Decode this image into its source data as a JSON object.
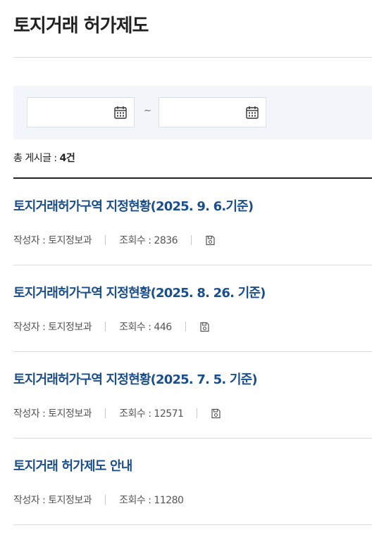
{
  "page": {
    "title": "토지거래 허가제도"
  },
  "filter": {
    "start_date_value": "",
    "end_date_value": "",
    "separator": "~",
    "calendar_icon": "calendar-icon"
  },
  "summary": {
    "label": "총 게시글 : ",
    "count": "4건"
  },
  "posts": [
    {
      "title": "토지거래허가구역 지정현황(2025. 9. 6.기준)",
      "author_label": "작성자 : 토지정보과",
      "views_label": "조회수 : 2836",
      "has_attachment": true
    },
    {
      "title": "토지거래허가구역 지정현황(2025. 8. 26. 기준)",
      "author_label": "작성자 : 토지정보과",
      "views_label": "조회수 : 446",
      "has_attachment": true
    },
    {
      "title": "토지거래허가구역 지정현황(2025. 7. 5. 기준)",
      "author_label": "작성자 : 토지정보과",
      "views_label": "조회수 : 12571",
      "has_attachment": true
    },
    {
      "title": "토지거래 허가제도 안내",
      "author_label": "작성자 : 토지정보과",
      "views_label": "조회수 : 11280",
      "has_attachment": false
    }
  ],
  "colors": {
    "title_link": "#1a4e8c",
    "filter_bg": "#f2f5f9",
    "list_top_border": "#222222"
  }
}
